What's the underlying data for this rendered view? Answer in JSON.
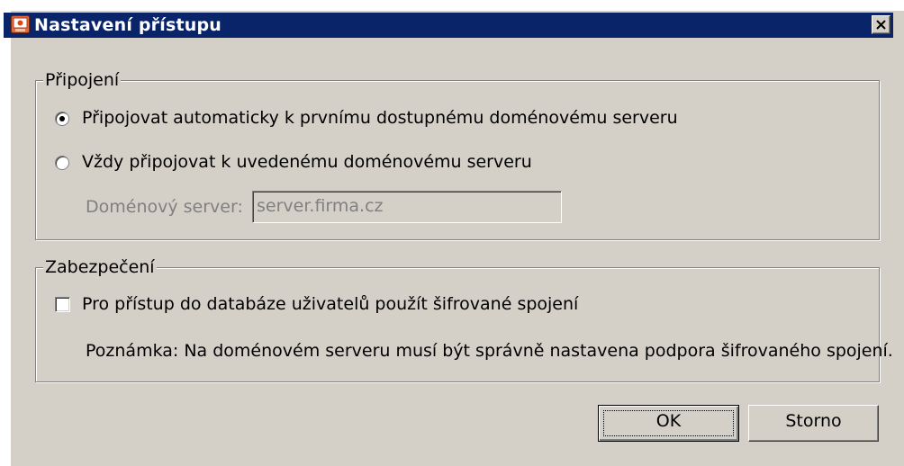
{
  "window": {
    "title": "Nastavení přístupu",
    "icon": "network-settings-icon",
    "close_glyph": "close-icon"
  },
  "connection": {
    "legend": "Připojení",
    "option_auto": {
      "label": "Připojovat automaticky k prvnímu dostupnému doménovému serveru",
      "selected": true
    },
    "option_specific": {
      "label": "Vždy připojovat k uvedenému doménovému serveru",
      "selected": false
    },
    "server_label": "Doménový server:",
    "server_value": "server.firma.cz",
    "server_enabled": false
  },
  "security": {
    "legend": "Zabezpečení",
    "encrypt_label": "Pro přístup do databáze uživatelů použít šifrované spojení",
    "encrypt_checked": false,
    "note": "Poznámka: Na doménovém serveru musí být správně nastavena podpora šifrovaného spojení."
  },
  "buttons": {
    "ok": "OK",
    "cancel": "Storno"
  },
  "colors": {
    "titlebar": "#0a246a",
    "dialog_bg": "#d4d0c8"
  }
}
